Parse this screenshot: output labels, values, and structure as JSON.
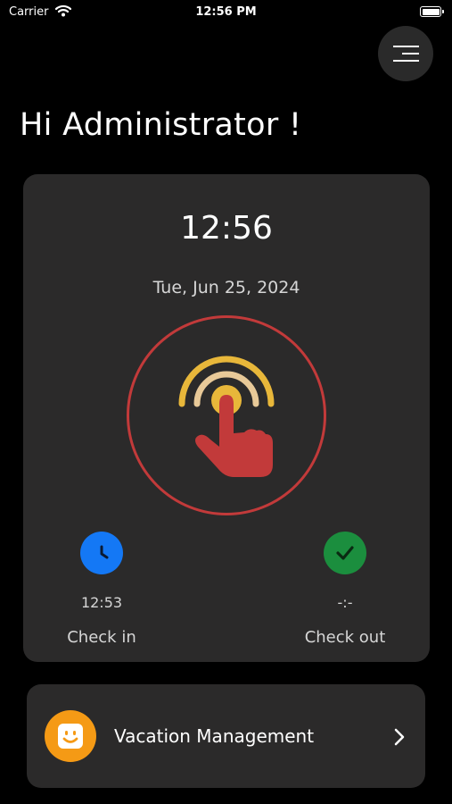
{
  "status_bar": {
    "carrier": "Carrier",
    "time": "12:56 PM"
  },
  "header": {
    "greeting": "Hi Administrator !"
  },
  "attendance": {
    "clock_time": "12:56",
    "date": "Tue, Jun 25, 2024",
    "check_in": {
      "time": "12:53",
      "label": "Check in"
    },
    "check_out": {
      "time": "-:-",
      "label": "Check out"
    }
  },
  "vacation": {
    "label": "Vacation Management"
  },
  "colors": {
    "background": "#000000",
    "card": "#2b2a2a",
    "punch_ring": "#c23a3a",
    "check_in": "#1478f5",
    "check_out": "#1b8e3e",
    "vacation_icon": "#f59a15"
  },
  "icons": [
    "wifi-icon",
    "battery-icon",
    "menu-icon",
    "tap-hand-icon",
    "clock-icon",
    "checkmark-icon",
    "smiley-icon",
    "chevron-right-icon"
  ]
}
